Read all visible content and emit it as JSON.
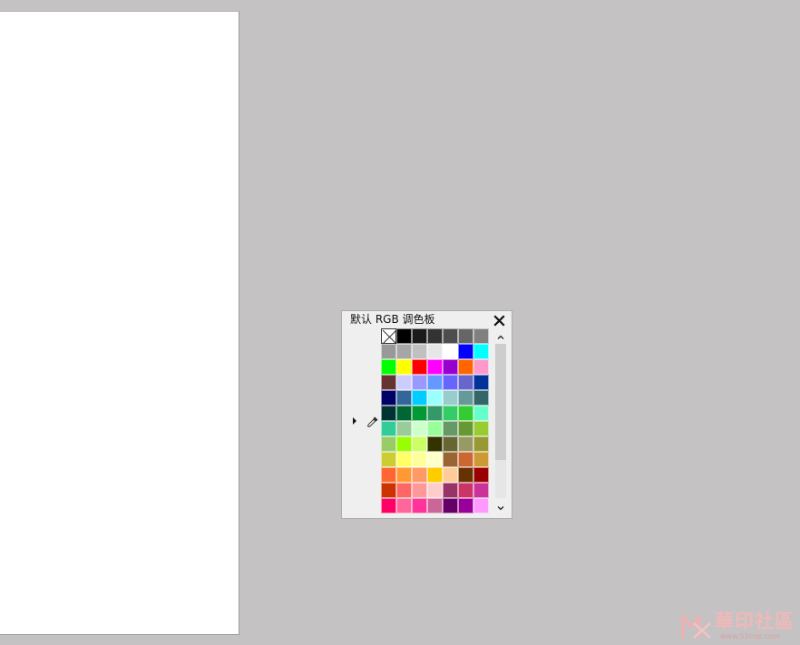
{
  "palette": {
    "title": "默认 RGB 调色板",
    "close_icon": "close-icon",
    "expand_icon": "triangle-right-icon",
    "eyedropper_icon": "eyedropper-icon",
    "scroll_up_icon": "chevron-up-icon",
    "scroll_down_icon": "chevron-down-icon",
    "no_color_swatch": "no-color",
    "swatches": [
      "#000000",
      "#1a1a1a",
      "#333333",
      "#4d4d4d",
      "#666666",
      "#808080",
      "#999999",
      "#a6a6a6",
      "#c0c0c0",
      "#e6e6e6",
      "#ffffff",
      "#0000ff",
      "#00ffff",
      "#00ff00",
      "#ffff00",
      "#ff0000",
      "#ff00ff",
      "#9900cc",
      "#ff6600",
      "#ff99cc",
      "#663333",
      "#ccccff",
      "#9999ff",
      "#6699ff",
      "#6666ff",
      "#6666cc",
      "#003399",
      "#000066",
      "#336699",
      "#00ccff",
      "#99ffff",
      "#99cccc",
      "#669999",
      "#336666",
      "#003333",
      "#006633",
      "#009933",
      "#339966",
      "#33cc66",
      "#33cc33",
      "#66ffcc",
      "#33cc99",
      "#99cc99",
      "#ccffcc",
      "#99ff99",
      "#669966",
      "#669933",
      "#99cc33",
      "#99cc66",
      "#99ff00",
      "#ccff66",
      "#333300",
      "#666633",
      "#999966",
      "#999933",
      "#cccc33",
      "#ffff66",
      "#ffff99",
      "#ffffcc",
      "#996633",
      "#cc6633",
      "#cc9933",
      "#ff6633",
      "#ff9933",
      "#ff9966",
      "#ffcc00",
      "#ffcc99",
      "#663300",
      "#990000",
      "#cc3300",
      "#ff6666",
      "#ff9999",
      "#ffcccc",
      "#993366",
      "#cc3366",
      "#cc3399",
      "#ff0066",
      "#ff6699",
      "#ff3399",
      "#cc6699",
      "#660066",
      "#990099",
      "#ff99ff"
    ]
  },
  "watermark": {
    "text": "華印社區",
    "url": "www.52cnp.com"
  }
}
